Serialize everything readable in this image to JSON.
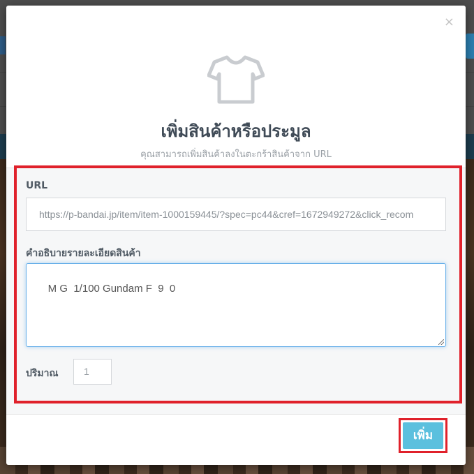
{
  "modal": {
    "close_label": "×",
    "title": "เพิ่มสินค้าหรือประมูล",
    "subtitle": "คุณสามารถเพิ่มสินค้าลงในตะกร้าสินค้าจาก URL",
    "icon": "tshirt-icon"
  },
  "form": {
    "url_label": "URL",
    "url_value": "https://p-bandai.jp/item/item-1000159445/?spec=pc44&cref=1672949272&click_recom",
    "description_label": "คำอธิบายรายละเอียดสินค้า",
    "description_value": "M G  1/100 Gundam F  9  0",
    "quantity_label": "ปริมาณ",
    "quantity_value": "1"
  },
  "actions": {
    "add_label": "เพิ่ม"
  },
  "colors": {
    "highlight": "#e0212b",
    "button": "#5bc0de",
    "title": "#3f4a56"
  }
}
